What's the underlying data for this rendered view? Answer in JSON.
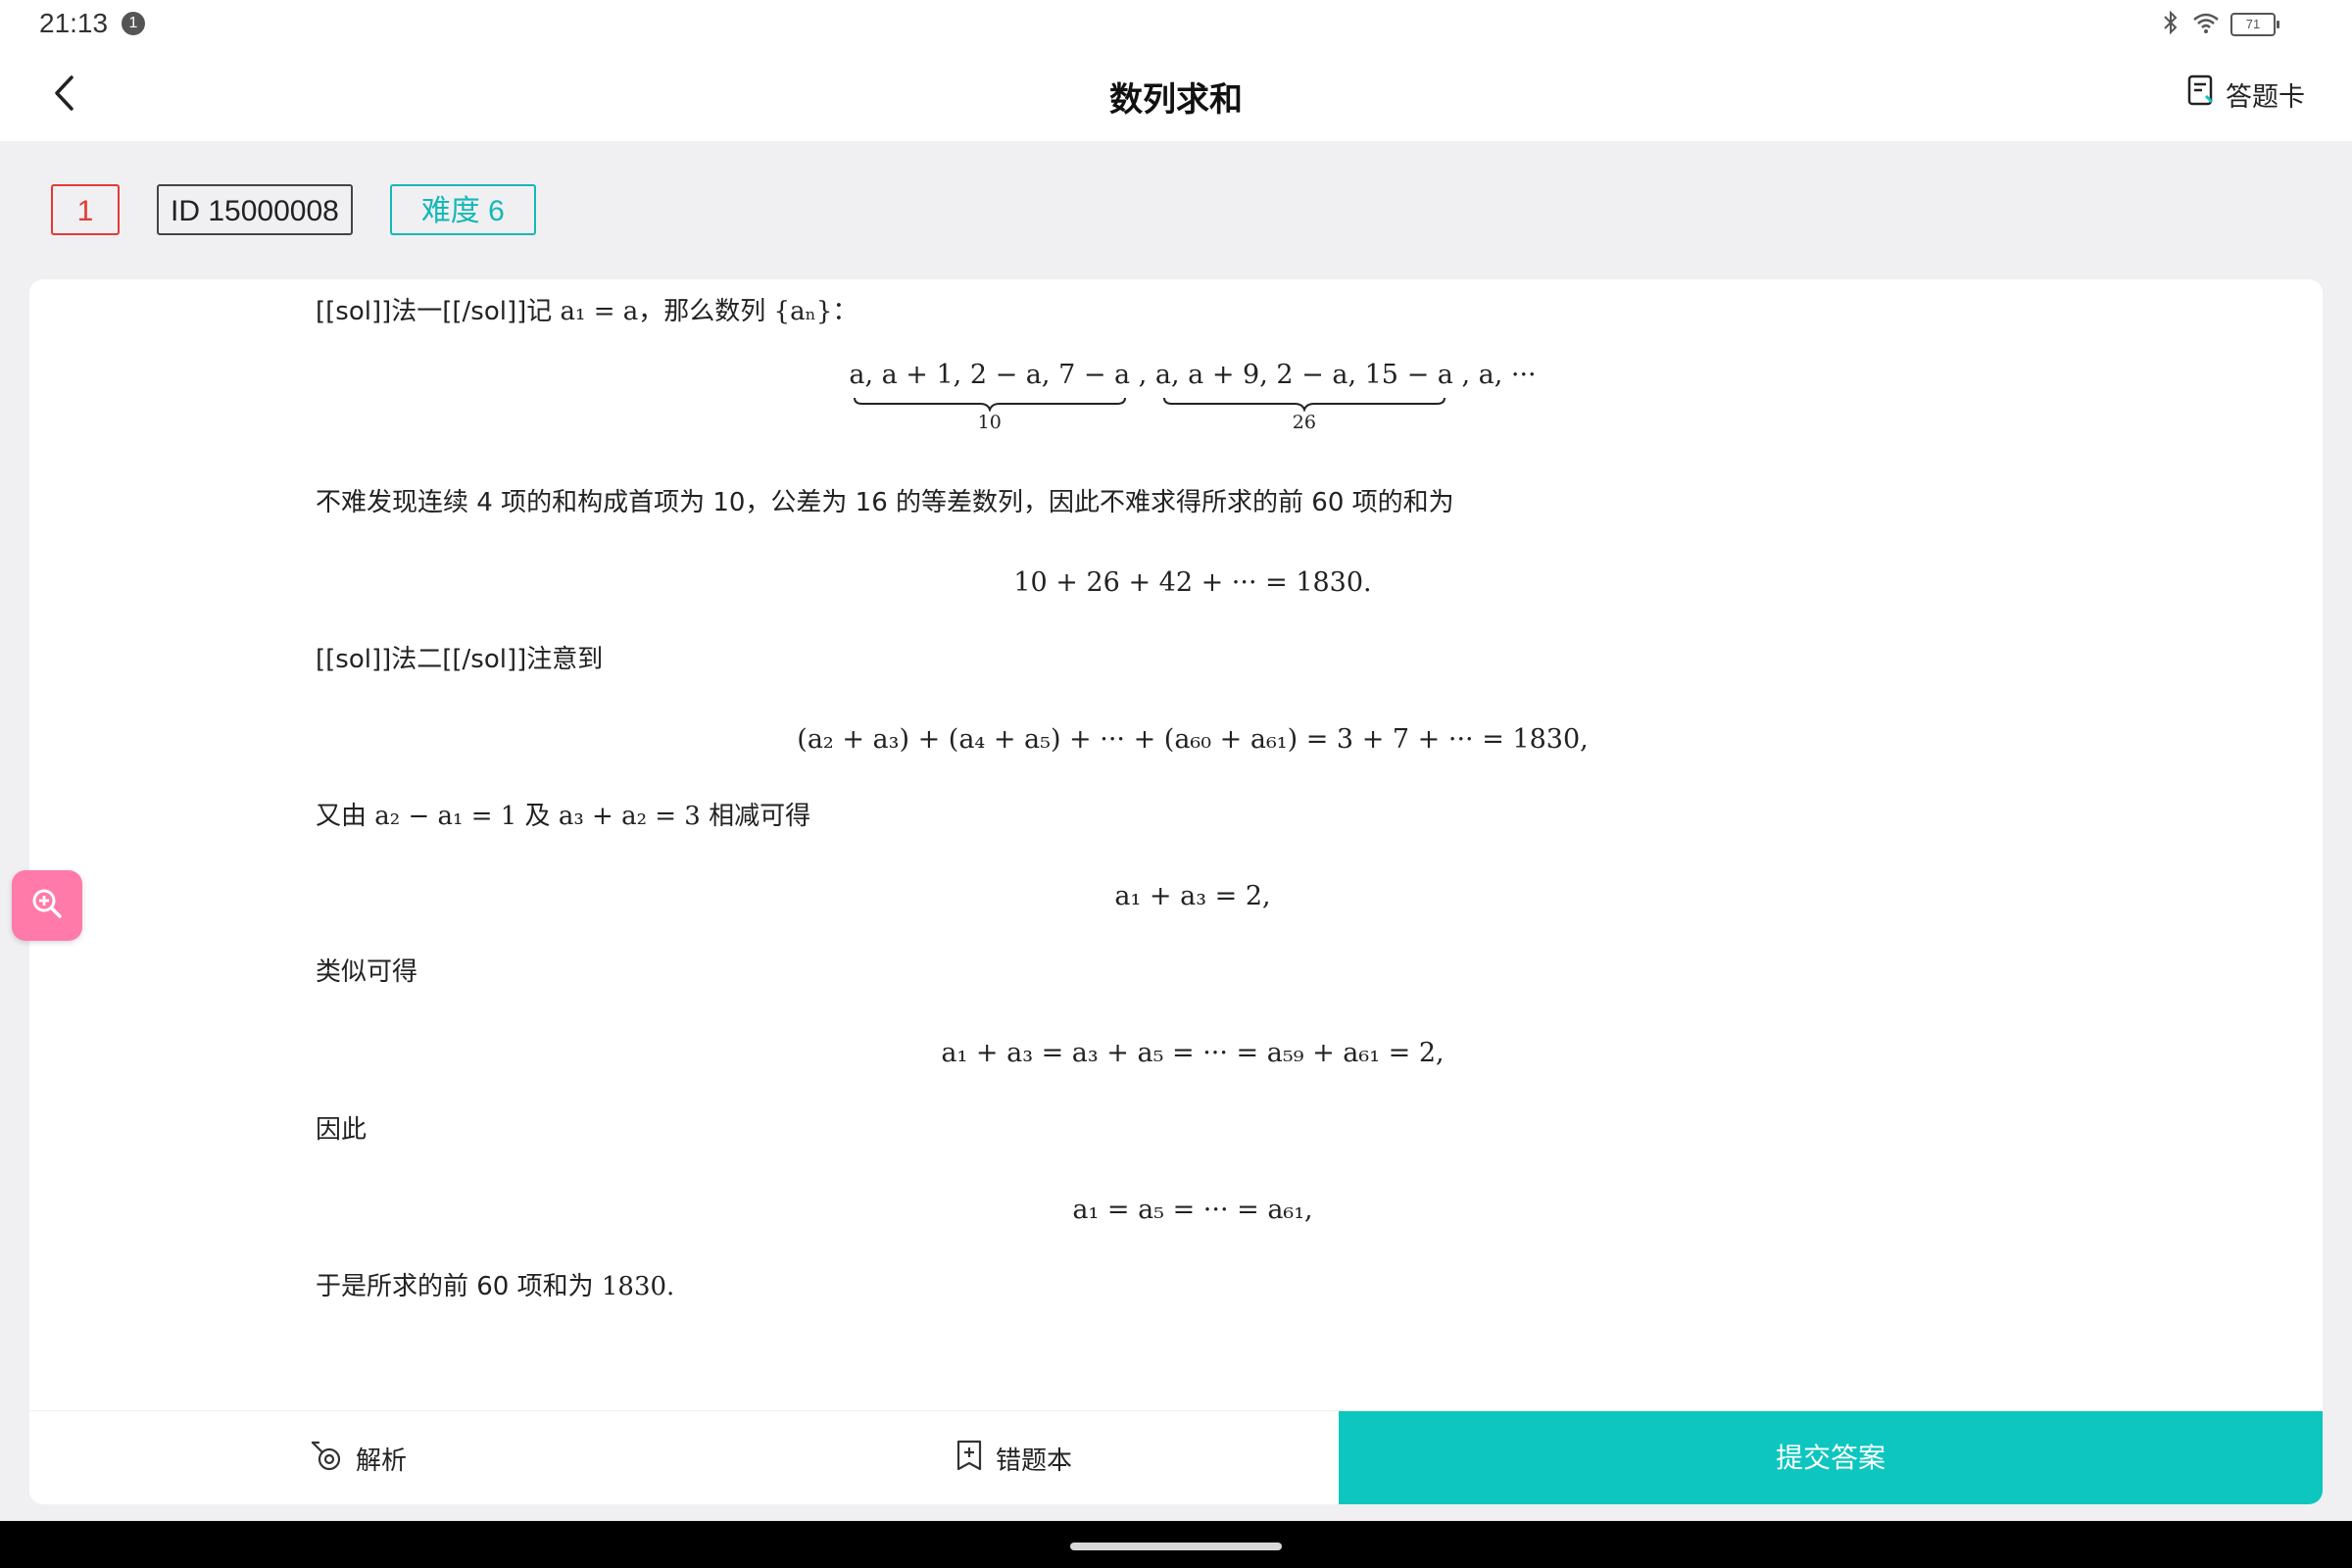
{
  "status": {
    "time": "21:13",
    "notification_count": "1",
    "battery": "71"
  },
  "header": {
    "title": "数列求和",
    "answer_card_label": "答题卡"
  },
  "tags": {
    "index": "1",
    "id": "ID 15000008",
    "difficulty": "难度 6"
  },
  "solution": {
    "p1_a": "[[sol]]法一[[/sol]]记 ",
    "p1_m1": "a₁ = a",
    "p1_b": "，那么数列 ",
    "p1_m2": "{aₙ}",
    "p1_c": "：",
    "d1_group1": "a, a + 1, 2 − a, 7 − a",
    "d1_sep1": " ,",
    "d1_group2": "a, a + 9, 2 − a, 15 − a",
    "d1_tail": " , a, ···",
    "d1_label1": "10",
    "d1_label2": "26",
    "p2": "不难发现连续 4 项的和构成首项为 10，公差为 16 的等差数列，因此不难求得所求的前 60 项的和为",
    "d2": "10 + 26 + 42 + ··· = 1830.",
    "p3": "[[sol]]法二[[/sol]]注意到",
    "d3": "(a₂ + a₃) + (a₄ + a₅) + ··· + (a₆₀ + a₆₁) = 3 + 7 + ··· = 1830,",
    "p4_a": "又由 ",
    "p4_m1": "a₂ − a₁ = 1",
    "p4_b": " 及 ",
    "p4_m2": "a₃ + a₂ = 3",
    "p4_c": " 相减可得",
    "d4": "a₁ + a₃ = 2,",
    "p5": "类似可得",
    "d5": "a₁ + a₃ = a₃ + a₅ = ··· = a₅₉ + a₆₁ = 2,",
    "p6": "因此",
    "d6": "a₁ = a₅ = ··· = a₆₁,",
    "p7_a": "于是所求的前 60 项和为 ",
    "p7_m": "1830."
  },
  "bottom": {
    "analysis_label": "解析",
    "wrongbook_label": "错题本",
    "submit_label": "提交答案"
  },
  "colors": {
    "accent": "#0cc6bf",
    "index_tag": "#e53935",
    "difficulty_tag": "#14b8b8",
    "zoom_button": "#ff7aa8"
  },
  "icons": [
    "back-arrow-icon",
    "answer-card-icon",
    "zoom-in-icon",
    "analysis-icon",
    "wrongbook-icon",
    "bluetooth-icon",
    "wifi-icon",
    "battery-icon"
  ]
}
